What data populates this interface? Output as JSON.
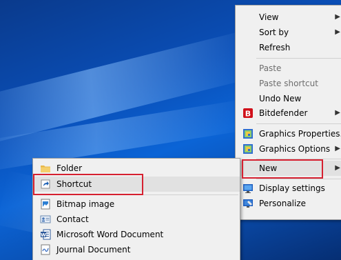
{
  "context_menu": {
    "items": [
      {
        "label": "View"
      },
      {
        "label": "Sort by"
      },
      {
        "label": "Refresh"
      },
      {
        "label": "Paste"
      },
      {
        "label": "Paste shortcut"
      },
      {
        "label": "Undo New"
      },
      {
        "label": "Bitdefender"
      },
      {
        "label": "Graphics Properties..."
      },
      {
        "label": "Graphics Options"
      },
      {
        "label": "New"
      },
      {
        "label": "Display settings"
      },
      {
        "label": "Personalize"
      }
    ]
  },
  "new_submenu": {
    "items": [
      {
        "label": "Folder"
      },
      {
        "label": "Shortcut"
      },
      {
        "label": "Bitmap image"
      },
      {
        "label": "Contact"
      },
      {
        "label": "Microsoft Word Document"
      },
      {
        "label": "Journal Document"
      }
    ]
  },
  "colors": {
    "highlight_box": "#d62030",
    "menu_background": "#f0f0f0",
    "bitdefender_red": "#d0101a"
  },
  "icons": {
    "bitdefender": "bitdefender-icon",
    "graphics_properties": "intel-graphics-icon",
    "graphics_options": "intel-graphics-icon",
    "display_settings": "display-icon",
    "personalize": "personalize-icon",
    "folder": "folder-icon",
    "shortcut": "shortcut-icon",
    "bitmap": "bitmap-icon",
    "contact": "contact-icon",
    "word": "word-icon",
    "journal": "journal-icon"
  }
}
